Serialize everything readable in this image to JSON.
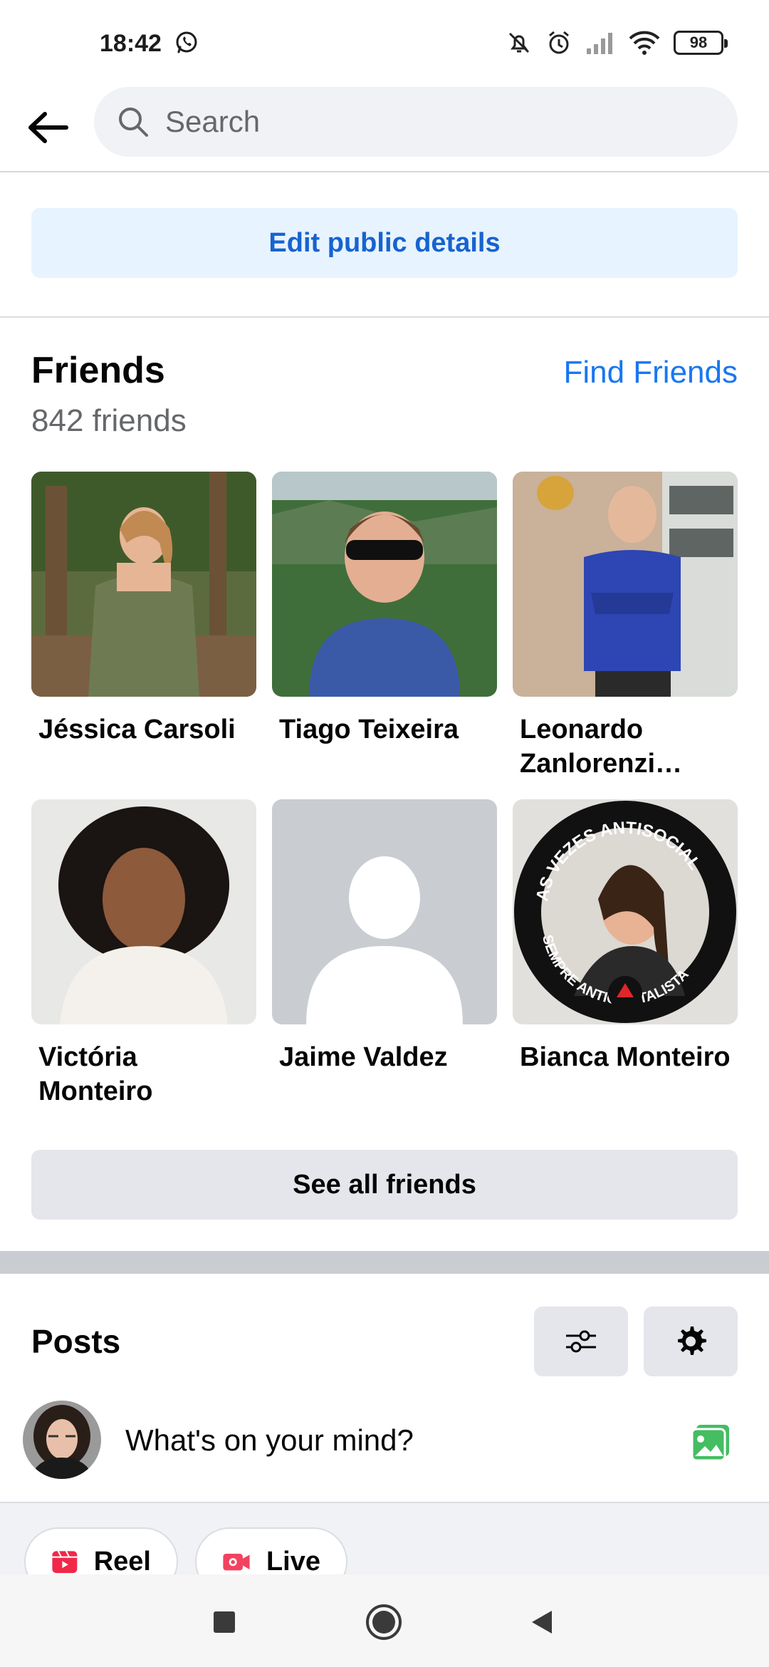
{
  "status_bar": {
    "time": "18:42",
    "battery": "98",
    "icons": [
      "whatsapp-icon",
      "mute-icon",
      "alarm-icon",
      "signal-icon",
      "wifi-icon",
      "battery-icon"
    ]
  },
  "search": {
    "placeholder": "Search"
  },
  "profile": {
    "edit_public_details_label": "Edit public details"
  },
  "friends": {
    "title": "Friends",
    "find_friends_label": "Find Friends",
    "count": "842 friends",
    "items": [
      {
        "name": "Jéssica Carsoli"
      },
      {
        "name": "Tiago Teixeira"
      },
      {
        "name": "Leonardo Zanlorenzi Gabriel"
      },
      {
        "name": "Victória Monteiro"
      },
      {
        "name": "Jaime Valdez"
      },
      {
        "name": "Bianca Monteiro"
      }
    ],
    "see_all_label": "See all friends",
    "avatar_badge_text": {
      "top": "AS VEZES ANTISOCIAL",
      "bottom": "SEMPRE ANTICAPITALISTA"
    }
  },
  "posts": {
    "title": "Posts",
    "composer_placeholder": "What's on your mind?",
    "reel_label": "Reel",
    "live_label": "Live"
  },
  "colors": {
    "brand_blue": "#1877f2",
    "edit_button_bg": "#e7f3ff",
    "button_gray": "#e4e6eb",
    "reel_red": "#f02849",
    "live_red": "#f3425f",
    "photo_green": "#45bd62"
  }
}
